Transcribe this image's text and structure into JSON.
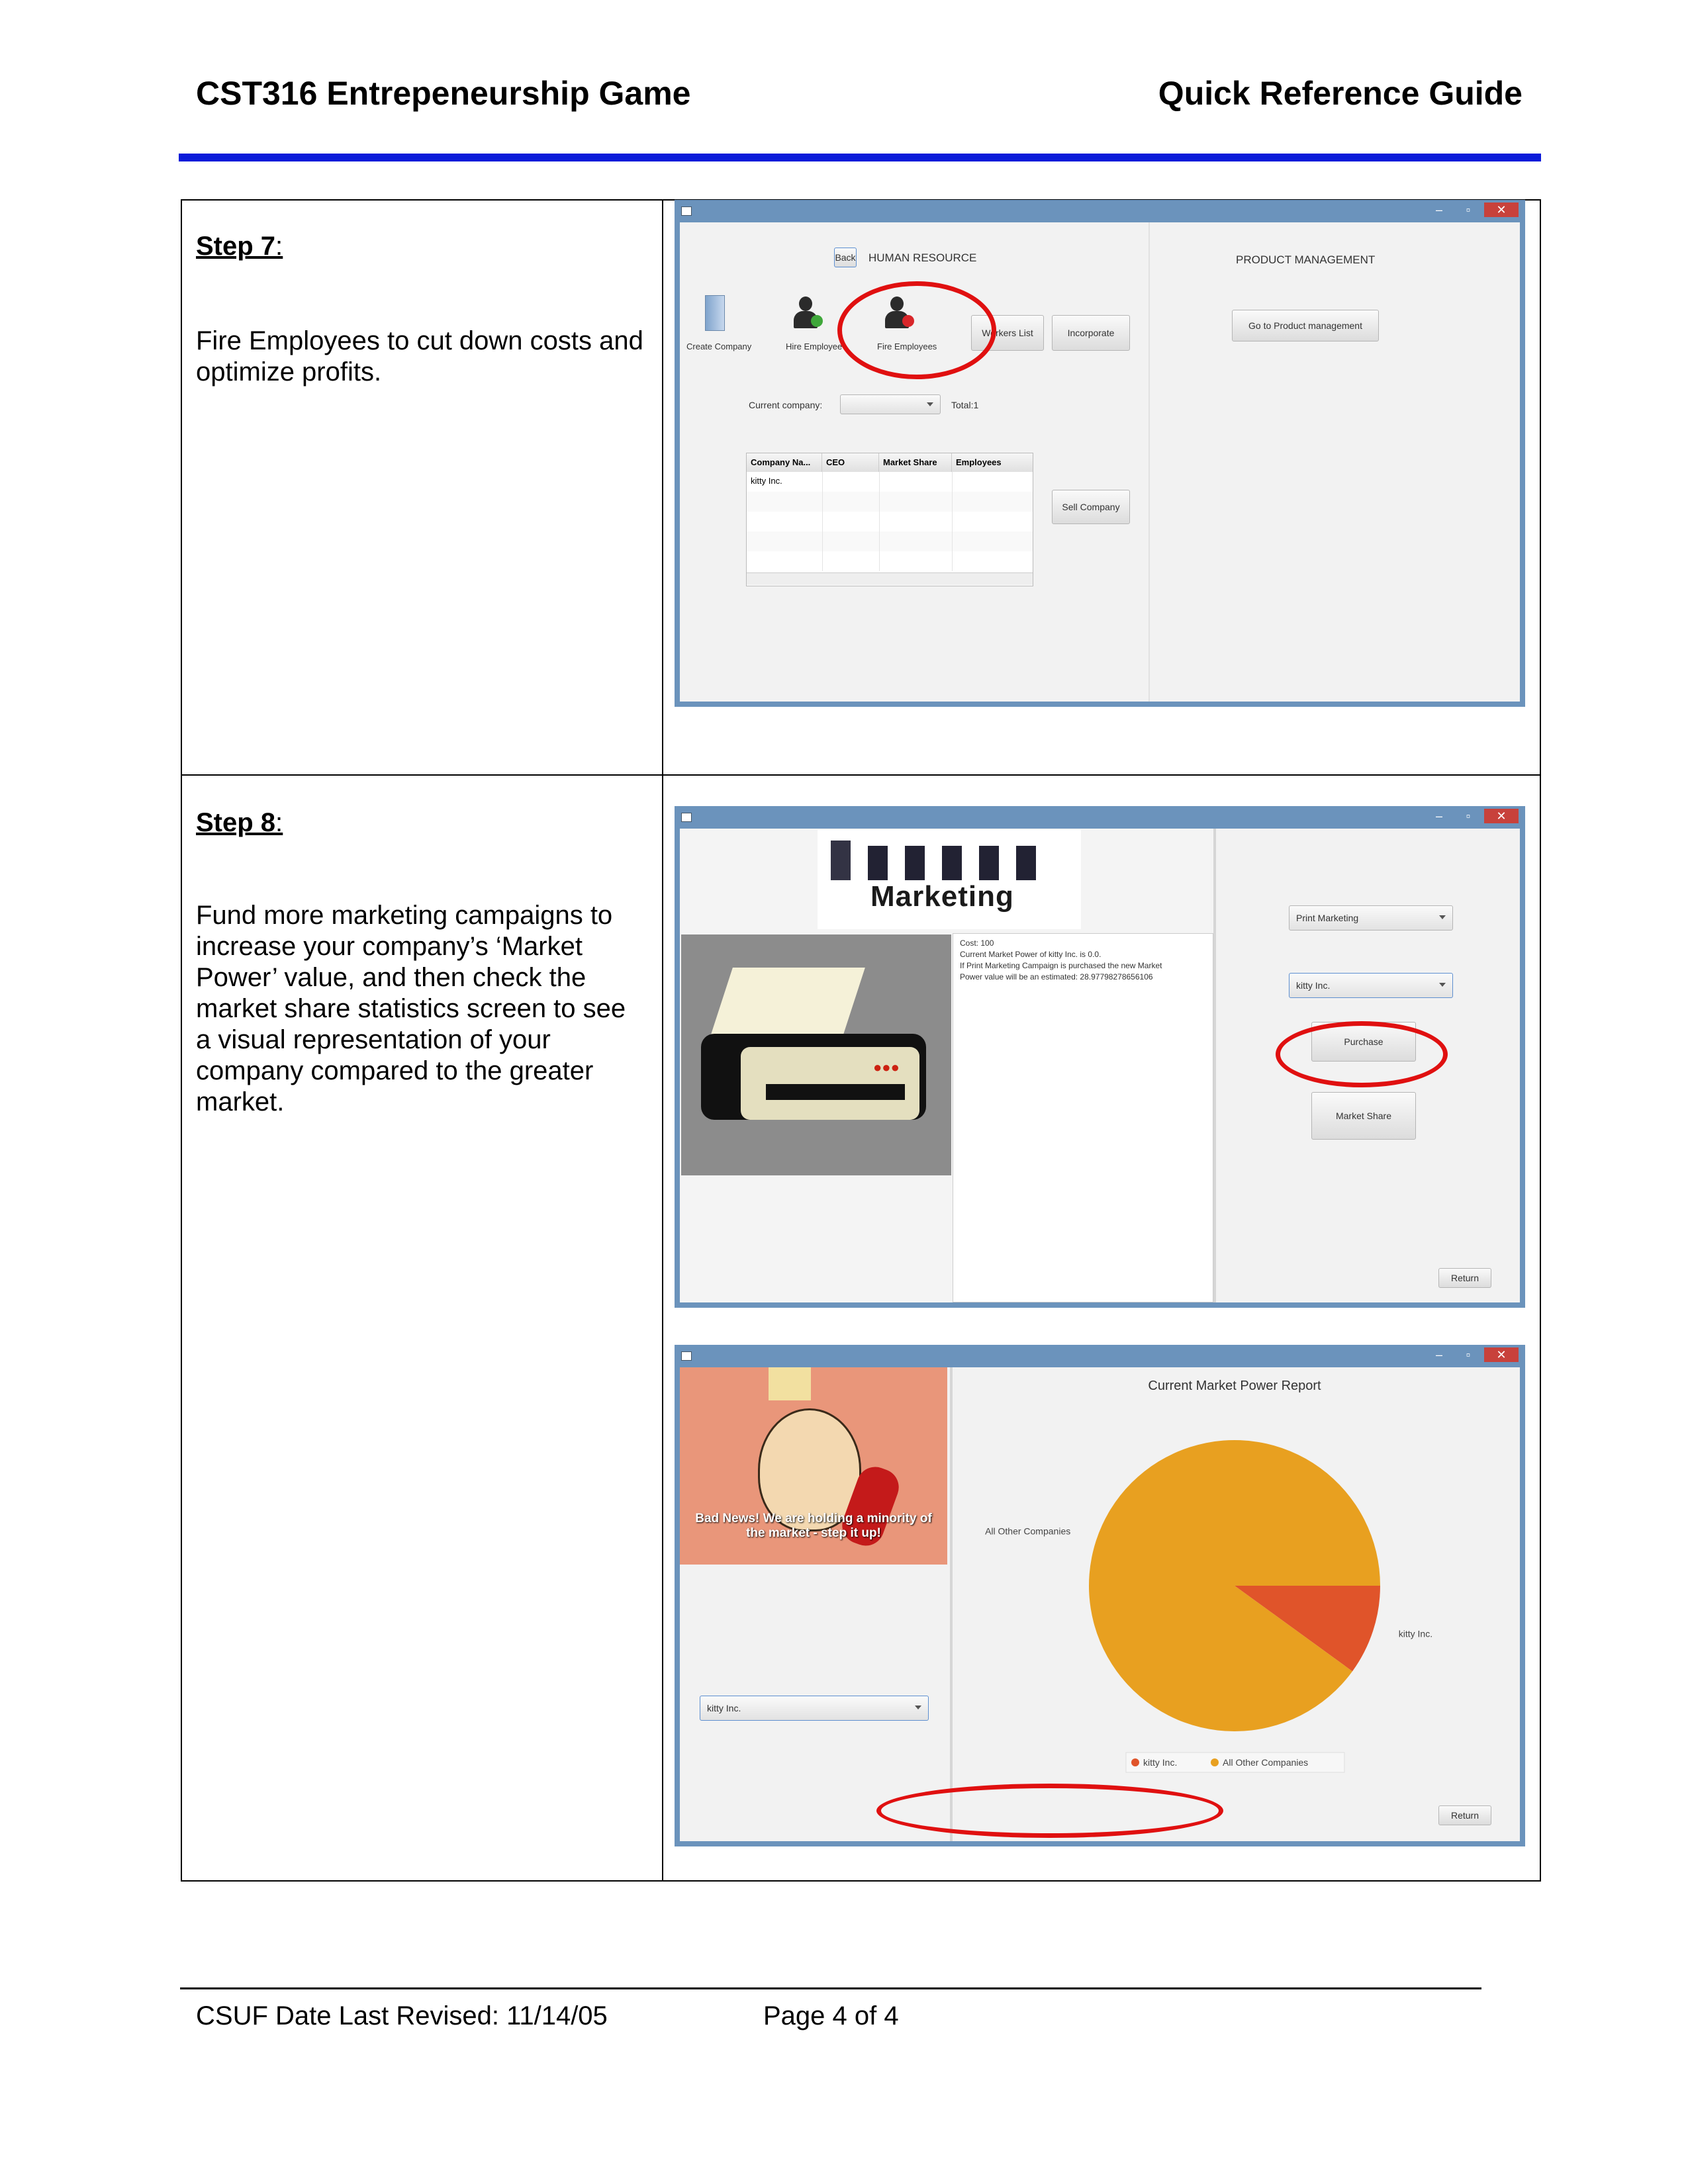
{
  "header": {
    "title": "CST316 Entrepeneurship Game",
    "right_title": "Quick Reference Guide"
  },
  "steps": [
    {
      "label": "Step 7",
      "colon": ":",
      "text": "Fire Employees to cut down costs and optimize profits."
    },
    {
      "label": "Step 8",
      "colon": ":",
      "text": "Fund more marketing campaigns to increase your company’s ‘Market Power’ value, and then check the market share statistics screen to see a visual representation of your company compared to the greater market."
    }
  ],
  "screen1": {
    "back_button": "Back",
    "section_title": "HUMAN RESOURCE",
    "product_title": "PRODUCT MANAGEMENT",
    "icons": [
      "Create Company",
      "Hire Employee",
      "Fire Employees"
    ],
    "workers_list_button": "Workers List",
    "incorporate_button": "Incorporate",
    "product_button": "Go to Product management",
    "current_company_label": "Current company:",
    "total_label": "Total:1",
    "table_headers": [
      "Company Na...",
      "CEO",
      "Market Share",
      "Employees"
    ],
    "table_rows": [
      [
        "kitty Inc.",
        "",
        "",
        ""
      ]
    ],
    "sell_button": "Sell Company"
  },
  "screen2": {
    "banner_text": "Marketing",
    "info_lines": [
      "Cost: 100",
      "Current Market Power of kitty Inc. is 0.0.",
      "If Print Marketing Campaign is purchased the new Market",
      "Power value will be an estimated: 28.97798278656106"
    ],
    "campaign_combo": "Print Marketing",
    "company_combo": "kitty Inc.",
    "purchase_button": "Purchase",
    "market_share_button": "Market Share",
    "return_button": "Return"
  },
  "screen3": {
    "meme_text_line1": "Bad News! We are holding a minority of",
    "meme_text_line2": "the market - step it up!",
    "company_combo": "kitty Inc.",
    "return_button": "Return"
  },
  "chart_data": {
    "type": "pie",
    "title": "Current Market Power Report",
    "categories": [
      "kitty Inc.",
      "All Other Companies"
    ],
    "values": [
      10,
      90
    ],
    "colors": [
      "#e0542a",
      "#e8a020"
    ],
    "legend": "bottom"
  },
  "footer": {
    "left": "CSUF Date Last Revised: 11/14/05",
    "page": "Page 4 of 4"
  }
}
